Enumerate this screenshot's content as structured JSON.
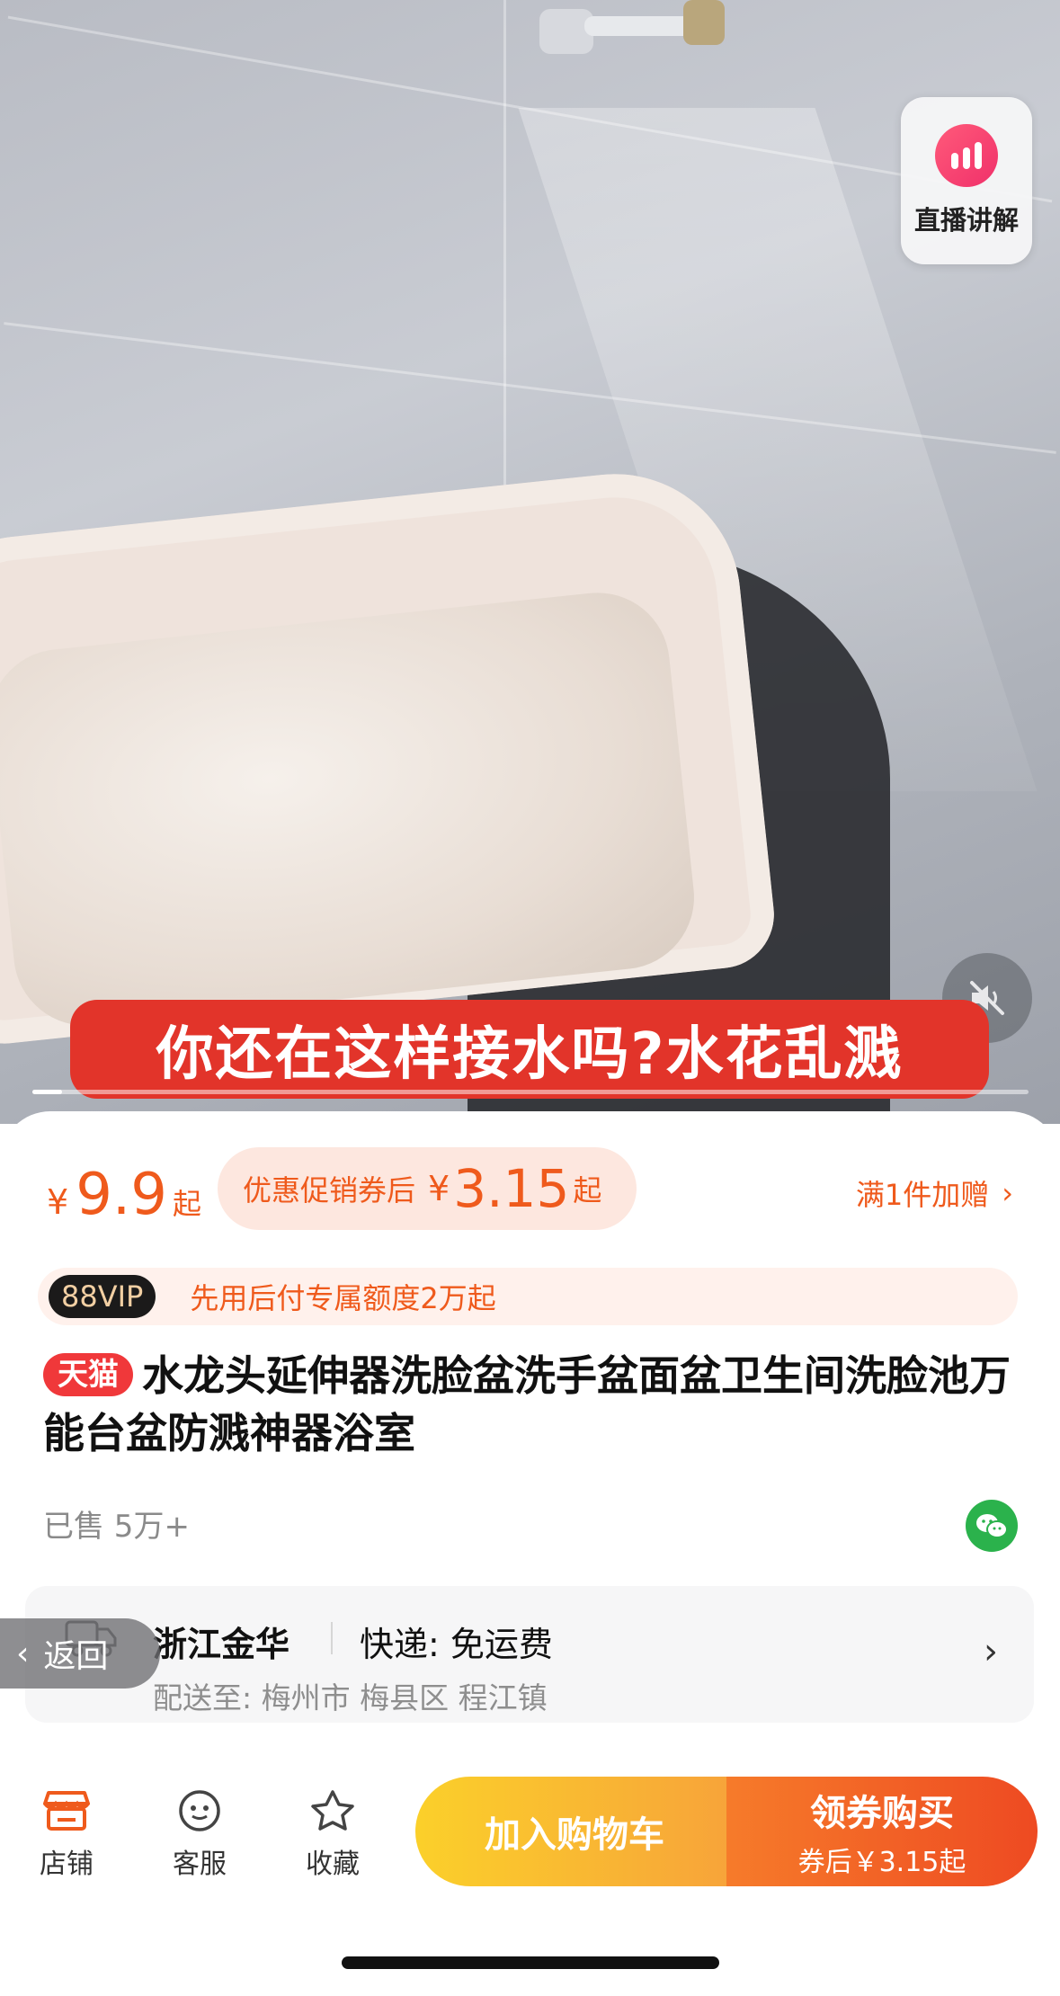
{
  "hero": {
    "caption": "你还在这样接水吗?水花乱溅",
    "live_label": "直播讲解",
    "video_progress": 0.03,
    "muted": true
  },
  "price": {
    "currency": "¥",
    "value": "9.9",
    "suffix": "起"
  },
  "coupon": {
    "label": "优惠促销券后",
    "currency": "¥",
    "value": "3.15",
    "suffix": "起"
  },
  "gift": {
    "label": "满1件加赠"
  },
  "vip": {
    "badge": "88VIP",
    "text": "先用后付专属额度2万起"
  },
  "product": {
    "tag": "天猫",
    "title": "水龙头延伸器洗脸盆洗手盆面盆卫生间洗脸池万能台盆防溅神器浴室",
    "sold": "已售 5万+"
  },
  "shipping": {
    "origin": "浙江金华",
    "express": "快递: 免运费",
    "destination": "配送至: 梅州市 梅县区 程江镇"
  },
  "back_button": {
    "label": "返回"
  },
  "actions": {
    "store": "店铺",
    "service": "客服",
    "favorite": "收藏",
    "add_to_cart": "加入购物车",
    "buy_main": "领券购买",
    "buy_sub": "券后￥3.15起"
  },
  "colors": {
    "accent": "#ef5a1c",
    "caption_bg": "#e2342a",
    "tmall_red": "#f0383a"
  }
}
